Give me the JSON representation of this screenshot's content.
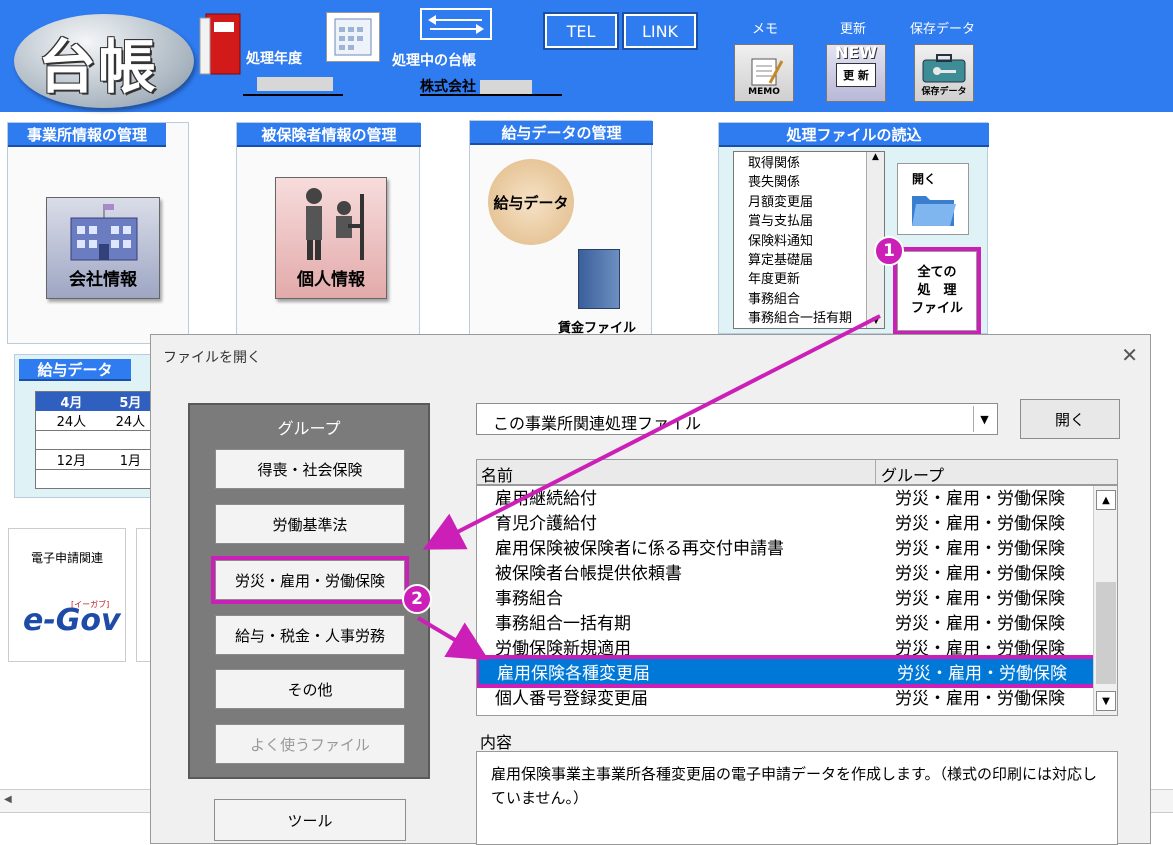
{
  "header": {
    "logo_text": "台帳",
    "year_label": "処理年度",
    "ledger_label": "処理中の台帳",
    "company_name": "株式会社",
    "tel_label": "TEL",
    "link_label": "LINK",
    "memo_label": "メモ",
    "memo_icon_text": "MEMO",
    "update_label": "更新",
    "update_icon_text": "更 新",
    "new_badge": "NEW",
    "save_label": "保存データ",
    "save_icon_text": "保存データ"
  },
  "panels": {
    "office_title": "事業所情報の管理",
    "office_icon": "会社情報",
    "insured_title": "被保険者情報の管理",
    "insured_icon": "個人情報",
    "salary_title": "給与データの管理",
    "salary_icon": "給与データ",
    "wage_file": "賃金ファイル",
    "files_title": "処理ファイルの読込",
    "file_list": [
      "取得関係",
      "喪失関係",
      "月額変更届",
      "賞与支払届",
      "保険料通知",
      "算定基礎届",
      "年度更新",
      "事務組合",
      "事務組合一括有期"
    ],
    "open_label": "開く",
    "all_files_line1": "全ての",
    "all_files_line2": "処　理",
    "all_files_line3": "ファイル"
  },
  "salary_table": {
    "title": "給与データ",
    "m1": "4月",
    "m2": "5月",
    "c1": "24人",
    "c2": "24人",
    "m3": "12月",
    "m4": "1月"
  },
  "egov": {
    "label": "電子申請関連",
    "logo": "e-Gov",
    "sub": "[イーガブ]"
  },
  "dialog": {
    "title": "ファイルを開く",
    "group_heading": "グループ",
    "groups": [
      "得喪・社会保険",
      "労働基準法",
      "労災・雇用・労働保険",
      "給与・税金・人事労務",
      "その他",
      "よく使うファイル"
    ],
    "tool_label": "ツール",
    "combo_value": "この事業所関連処理ファイル",
    "open_button": "開く",
    "col_name": "名前",
    "col_group": "グループ",
    "rows": [
      {
        "name": "雇用継続給付",
        "group": "労災・雇用・労働保険"
      },
      {
        "name": "育児介護給付",
        "group": "労災・雇用・労働保険"
      },
      {
        "name": "雇用保険被保険者に係る再交付申請書",
        "group": "労災・雇用・労働保険"
      },
      {
        "name": "被保険者台帳提供依頼書",
        "group": "労災・雇用・労働保険"
      },
      {
        "name": "事務組合",
        "group": "労災・雇用・労働保険"
      },
      {
        "name": "事務組合一括有期",
        "group": "労災・雇用・労働保険"
      },
      {
        "name": "労働保険新規適用",
        "group": "労災・雇用・労働保険"
      },
      {
        "name": "雇用保険各種変更届",
        "group": "労災・雇用・労働保険"
      },
      {
        "name": "個人番号登録変更届",
        "group": "労災・雇用・労働保険"
      }
    ],
    "content_label": "内容",
    "content_text": "雇用保険事業主事業所各種変更届の電子申請データを作成します。（様式の印刷には対応していません。）"
  },
  "annotations": {
    "badge1": "1",
    "badge2": "2"
  },
  "colors": {
    "accent": "#2f7bf0",
    "highlight": "#cc1fb8",
    "selected_row": "#0078d7"
  }
}
